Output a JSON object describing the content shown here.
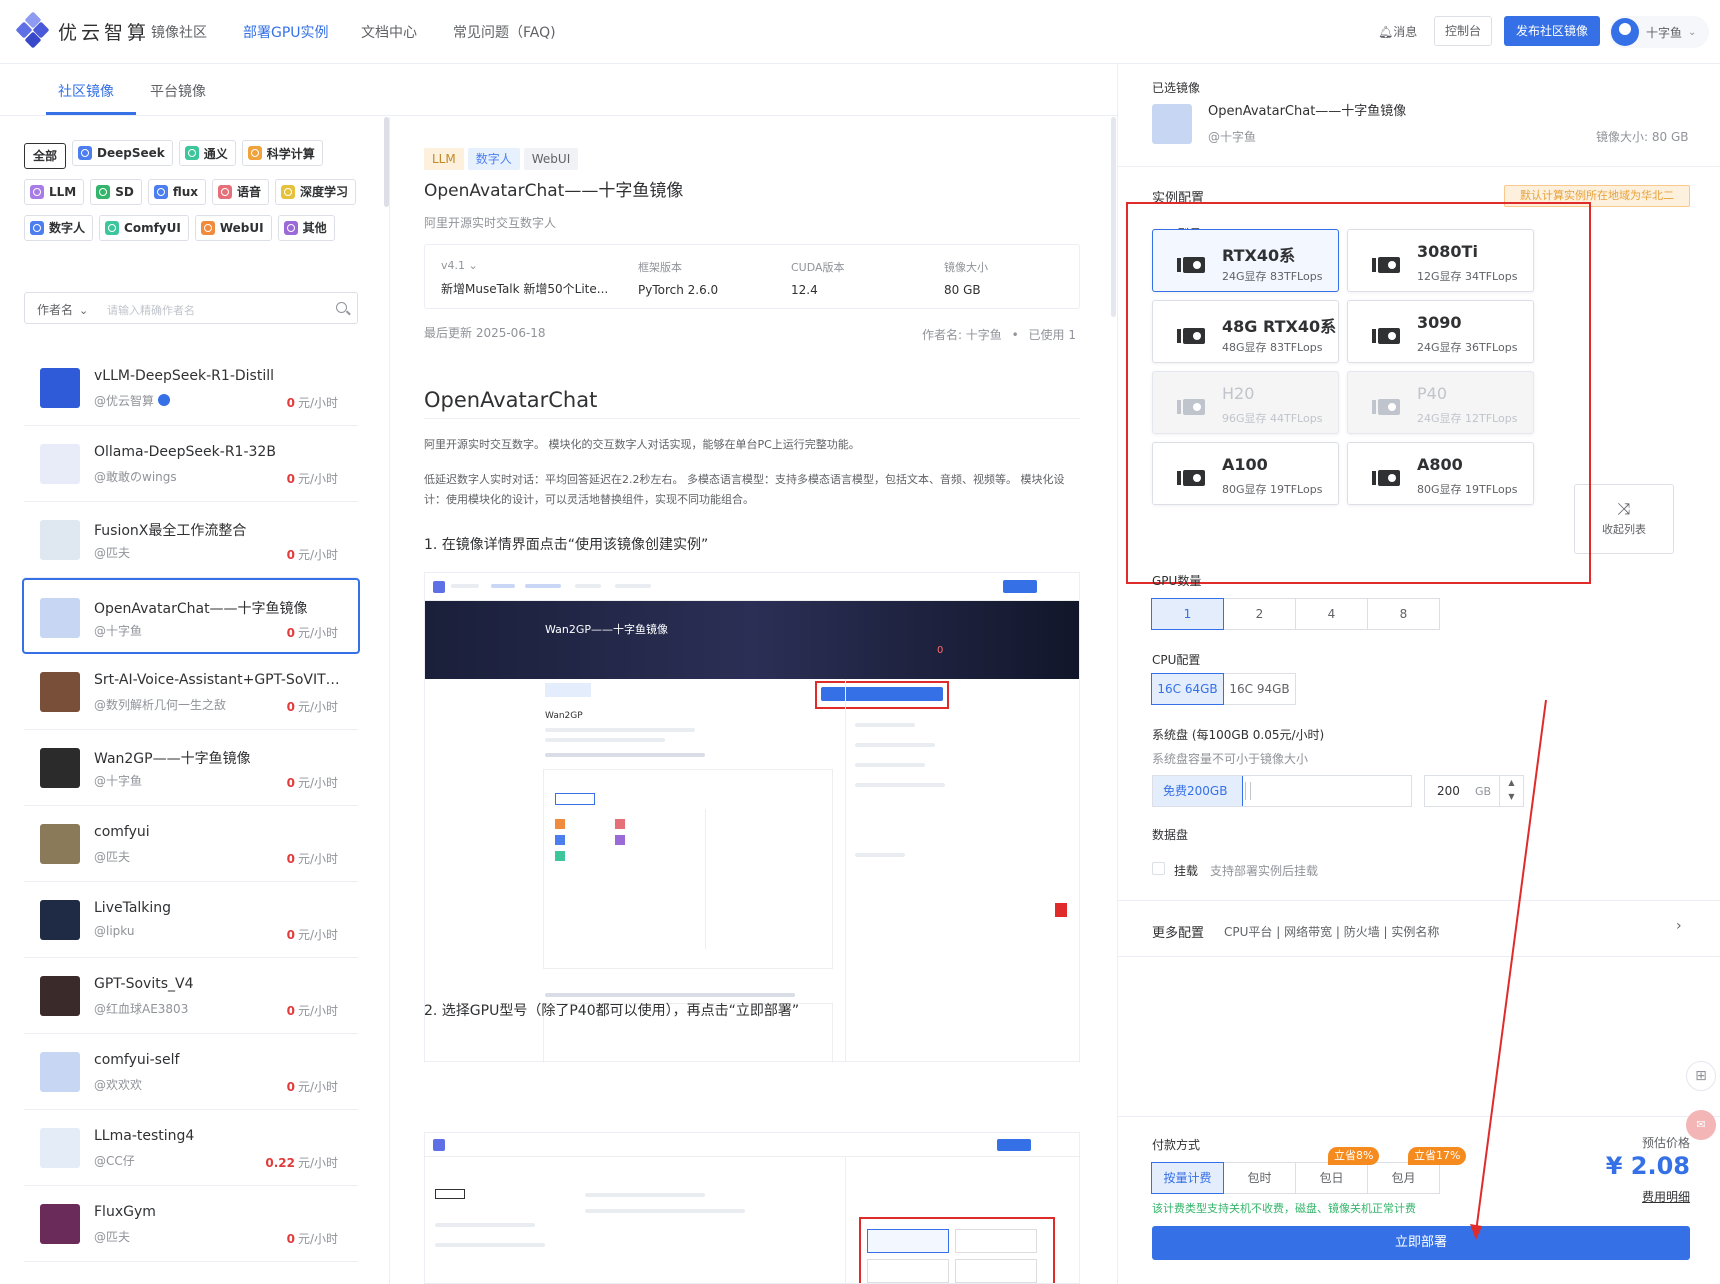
{
  "brand": {
    "name": "优云智算"
  },
  "nav": [
    "镜像社区",
    "部署GPU实例",
    "文档中心",
    "常见问题（FAQ)"
  ],
  "nav_active": 1,
  "header": {
    "messages": "消息",
    "console": "控制台",
    "publish": "发布社区镜像",
    "username": "十字鱼"
  },
  "tabs": [
    "社区镜像",
    "平台镜像"
  ],
  "filters": [
    {
      "label": "全部",
      "color": ""
    },
    {
      "label": "DeepSeek",
      "color": "#4c7ef0"
    },
    {
      "label": "通义",
      "color": "#3dc59b"
    },
    {
      "label": "科学计算",
      "color": "#f0a23c"
    },
    {
      "label": "LLM",
      "color": "#a77be8"
    },
    {
      "label": "SD",
      "color": "#35b56b"
    },
    {
      "label": "flux",
      "color": "#4c7ef0"
    },
    {
      "label": "语音",
      "color": "#e6707a"
    },
    {
      "label": "深度学习",
      "color": "#e6c23c"
    },
    {
      "label": "数字人",
      "color": "#4c7ef0"
    },
    {
      "label": "ComfyUI",
      "color": "#3dc59b"
    },
    {
      "label": "WebUI",
      "color": "#f08a3c"
    },
    {
      "label": "其他",
      "color": "#9b6ad6"
    }
  ],
  "search": {
    "field": "作者名",
    "placeholder": "请输入精确作者名"
  },
  "images": [
    {
      "title": "vLLM-DeepSeek-R1-Distill",
      "author": "@优云智算",
      "price": "0",
      "unit": "元/小时",
      "verified": true,
      "thumb": "#2f5bd8"
    },
    {
      "title": "Ollama-DeepSeek-R1-32B",
      "author": "@敢敢のwings",
      "price": "0",
      "unit": "元/小时",
      "thumb": "#e8ecf8"
    },
    {
      "title": "FusionX最全工作流整合",
      "author": "@匹夫",
      "price": "0",
      "unit": "元/小时",
      "thumb": "#dfe7f0"
    },
    {
      "title": "OpenAvatarChat——十字鱼镜像",
      "author": "@十字鱼",
      "price": "0",
      "unit": "元/小时",
      "selected": true,
      "thumb": "#c7d6f3"
    },
    {
      "title": "Srt-AI-Voice-Assistant+GPT-SoVITS...",
      "author": "@数列解析几何一生之敌",
      "price": "0",
      "unit": "元/小时",
      "thumb": "#7a4f3a"
    },
    {
      "title": "Wan2GP——十字鱼镜像",
      "author": "@十字鱼",
      "price": "0",
      "unit": "元/小时",
      "thumb": "#2b2b2b"
    },
    {
      "title": "comfyui",
      "author": "@匹夫",
      "price": "0",
      "unit": "元/小时",
      "thumb": "#8a7a5a"
    },
    {
      "title": "LiveTalking",
      "author": "@lipku",
      "price": "0",
      "unit": "元/小时",
      "thumb": "#1f2a44"
    },
    {
      "title": "GPT-Sovits_V4",
      "author": "@红血球AE3803",
      "price": "0",
      "unit": "元/小时",
      "thumb": "#3b2a2a"
    },
    {
      "title": "comfyui-self",
      "author": "@欢欢欢",
      "price": "0",
      "unit": "元/小时",
      "thumb": "#c7d6f3"
    },
    {
      "title": "LLma-testing4",
      "author": "@CC仔",
      "price": "0.22",
      "unit": "元/小时",
      "thumb": "#e4ecf8"
    },
    {
      "title": "FluxGym",
      "author": "@匹夫",
      "price": "0",
      "unit": "元/小时",
      "thumb": "#6a2a5a"
    }
  ],
  "detail": {
    "tags": [
      {
        "label": "LLM",
        "bg": "#fdf0dc",
        "fg": "#c08a2a"
      },
      {
        "label": "数字人",
        "bg": "#e6f1fd",
        "fg": "#4c7ef0"
      },
      {
        "label": "WebUI",
        "bg": "#f0f2f5",
        "fg": "#606266"
      }
    ],
    "title": "OpenAvatarChat——十字鱼镜像",
    "subtitle": "阿里开源实时交互数字人",
    "version_label": "v4.1",
    "version_note": "新增MuseTalk 新增50个Lite...",
    "framework_label": "框架版本",
    "framework": "PyTorch 2.6.0",
    "cuda_label": "CUDA版本",
    "cuda": "12.4",
    "size_label": "镜像大小",
    "size": "80 GB",
    "updated": "最后更新 2025-06-18",
    "author_meta": "作者名: 十字鱼",
    "used_meta": "已使用 1",
    "heading": "OpenAvatarChat",
    "para1": "阿里开源实时交互数字。 模块化的交互数字人对话实现，能够在单台PC上运行完整功能。",
    "para2": "低延迟数字人实时对话：平均回答延迟在2.2秒左右。 多模态语言模型：支持多模态语言模型，包括文本、音频、视频等。 模块化设计：使用模块化的设计，可以灵活地替换组件，实现不同功能组合。",
    "step1": "1. 在镜像详情界面点击“使用该镜像创建实例”",
    "step2": "2. 选择GPU型号（除了P40都可以使用），再点击“立即部署”",
    "shot1_title": "Wan2GP——十字鱼镜像",
    "shot1_heading": "Wan2GP",
    "shot1_zero": "0"
  },
  "panel": {
    "selected_label": "已选镜像",
    "selected_name": "OpenAvatarChat——十字鱼镜像",
    "selected_author": "@十字鱼",
    "selected_size": "镜像大小: 80 GB",
    "config_label": "实例配置",
    "region_note": "默认计算实例所在地域为华北二",
    "gpu_model_label": "GPU型号",
    "gpus": [
      {
        "name": "RTX40系",
        "spec": "24G显存 83TFLops",
        "state": "selected"
      },
      {
        "name": "3080Ti",
        "spec": "12G显存 34TFLops",
        "state": "normal"
      },
      {
        "name": "48G RTX40系",
        "spec": "48G显存 83TFLops",
        "state": "normal"
      },
      {
        "name": "3090",
        "spec": "24G显存 36TFLops",
        "state": "normal"
      },
      {
        "name": "H20",
        "spec": "96G显存 44TFLops",
        "state": "disabled"
      },
      {
        "name": "P40",
        "spec": "24G显存 12TFLops",
        "state": "disabled"
      },
      {
        "name": "A100",
        "spec": "80G显存 19TFLops",
        "state": "normal"
      },
      {
        "name": "A800",
        "spec": "80G显存 19TFLops",
        "state": "normal"
      }
    ],
    "collapse": "收起列表",
    "gpu_count_label": "GPU数量",
    "gpu_counts": [
      "1",
      "2",
      "4",
      "8"
    ],
    "cpu_label": "CPU配置",
    "cpu_options": [
      "16C 64GB",
      "16C 94GB"
    ],
    "sysdisk_label": "系统盘  (每100GB 0.05元/小时)",
    "sysdisk_hint": "系统盘容量不可小于镜像大小",
    "sysdisk_free": "免费200GB",
    "sysdisk_value": "200",
    "sysdisk_unit": "GB",
    "datadisk_label": "数据盘",
    "datadisk_mount": "挂载",
    "datadisk_hint": "支持部署实例后挂载",
    "more_label": "更多配置",
    "more_items": "CPU平台 | 网络带宽 | 防火墙 | 实例名称",
    "pay_label": "付款方式",
    "pay_options": [
      "按量计费",
      "包时",
      "包日",
      "包月"
    ],
    "badge_day": "立省8%",
    "badge_month": "立省17%",
    "pay_note": "该计费类型支持关机不收费，磁盘、镜像关机正常计费",
    "price_label": "预估价格",
    "price": "¥ 2.08",
    "fee_detail": "费用明细",
    "deploy": "立即部署"
  },
  "colors": {
    "accent": "#3570e6",
    "price": "#e03c3c",
    "annotation": "#e02b2b"
  }
}
